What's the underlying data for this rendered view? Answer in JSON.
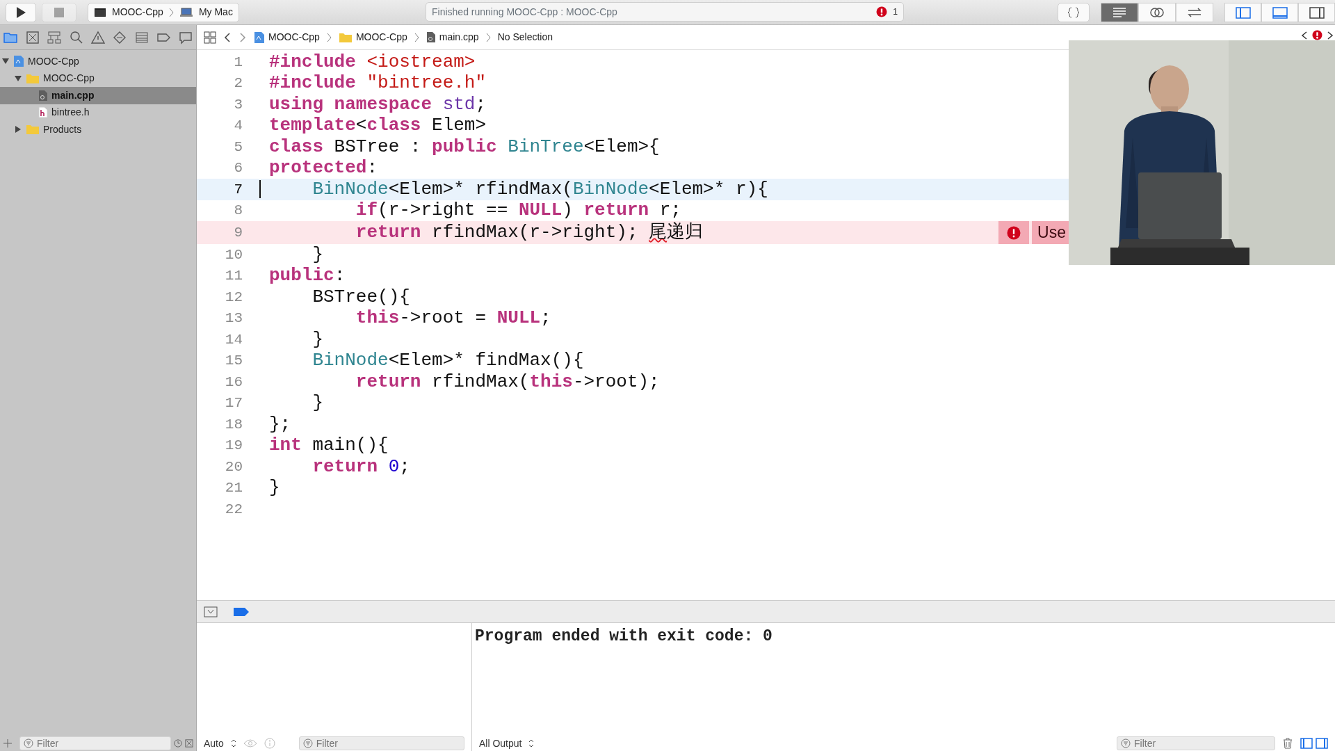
{
  "toolbar": {
    "run_button": {
      "disabled": false
    },
    "stop_button": {
      "disabled": true
    },
    "scheme": [
      {
        "label": "MOOC-Cpp",
        "kind": "app"
      },
      {
        "label": "My Mac",
        "kind": "mac"
      }
    ],
    "activity": {
      "text": "Finished running MOOC-Cpp : MOOC-Cpp",
      "error_count": "1"
    },
    "editor_modes": [
      {
        "kind": "braces",
        "selected": false
      }
    ],
    "editor_segments": [
      {
        "kind": "standard",
        "selected": true
      },
      {
        "kind": "assistant",
        "selected": false
      },
      {
        "kind": "version",
        "selected": false
      }
    ],
    "view_toggles": [
      {
        "kind": "navigator",
        "on": true
      },
      {
        "kind": "debug",
        "on": true
      },
      {
        "kind": "utilities",
        "on": false
      }
    ]
  },
  "navigator_tabs": [
    {
      "kind": "folder",
      "selected": true
    },
    {
      "kind": "source",
      "selected": false
    },
    {
      "kind": "symbol",
      "selected": false
    },
    {
      "kind": "search",
      "selected": false
    },
    {
      "kind": "warning",
      "selected": false
    },
    {
      "kind": "test",
      "selected": false
    },
    {
      "kind": "debug",
      "selected": false
    },
    {
      "kind": "breakpoint",
      "selected": false
    },
    {
      "kind": "report",
      "selected": false
    }
  ],
  "tree": [
    {
      "label": "MOOC-Cpp",
      "kind": "project",
      "expanded": true,
      "selected": false,
      "children": [
        {
          "label": "MOOC-Cpp",
          "kind": "folder",
          "expanded": true,
          "selected": false,
          "children": [
            {
              "label": "main.cpp",
              "kind": "cpp",
              "selected": true
            },
            {
              "label": "bintree.h",
              "kind": "header",
              "selected": false
            }
          ]
        },
        {
          "label": "Products",
          "kind": "folder",
          "expanded": false,
          "selected": false
        }
      ]
    }
  ],
  "sidebar_filter": {
    "placeholder": "Filter"
  },
  "jump_bar": [
    {
      "label": "MOOC-Cpp",
      "kind": "project"
    },
    {
      "label": "MOOC-Cpp",
      "kind": "folder"
    },
    {
      "label": "main.cpp",
      "kind": "cpp"
    },
    {
      "label": "No Selection",
      "kind": "none"
    }
  ],
  "code": [
    {
      "number": "1",
      "tokens": [
        {
          "text": "#include",
          "kind": "keyword"
        },
        {
          "text": " <iostream>",
          "kind": "string"
        }
      ]
    },
    {
      "number": "2",
      "tokens": [
        {
          "text": "#include",
          "kind": "keyword"
        },
        {
          "text": " \"bintree.h\"",
          "kind": "string"
        }
      ]
    },
    {
      "number": "3",
      "tokens": [
        {
          "text": "using",
          "kind": "keyword"
        },
        {
          "text": " namespace",
          "kind": "keyword"
        },
        {
          "text": " std",
          "kind": "library"
        },
        {
          "text": ";",
          "kind": "plain"
        }
      ]
    },
    {
      "number": "4",
      "tokens": [
        {
          "text": "template",
          "kind": "keyword"
        },
        {
          "text": "<",
          "kind": "plain"
        },
        {
          "text": "class",
          "kind": "keyword"
        },
        {
          "text": " Elem>",
          "kind": "plain"
        }
      ]
    },
    {
      "number": "5",
      "tokens": [
        {
          "text": "class",
          "kind": "keyword"
        },
        {
          "text": " BSTree : ",
          "kind": "plain"
        },
        {
          "text": "public",
          "kind": "keyword"
        },
        {
          "text": " BinTree",
          "kind": "type"
        },
        {
          "text": "<Elem>{",
          "kind": "plain"
        }
      ]
    },
    {
      "number": "6",
      "tokens": [
        {
          "text": "protected",
          "kind": "keyword"
        },
        {
          "text": ":",
          "kind": "plain"
        }
      ]
    },
    {
      "number": "7",
      "current": true,
      "tokens": [
        {
          "text": "    BinNode",
          "kind": "type"
        },
        {
          "text": "<Elem>* rfindMax(",
          "kind": "plain"
        },
        {
          "text": "BinNode",
          "kind": "type"
        },
        {
          "text": "<Elem>* r){",
          "kind": "plain"
        }
      ]
    },
    {
      "number": "8",
      "tokens": [
        {
          "text": "        if",
          "kind": "keyword"
        },
        {
          "text": "(r->right == ",
          "kind": "plain"
        },
        {
          "text": "NULL",
          "kind": "keyword"
        },
        {
          "text": ") ",
          "kind": "plain"
        },
        {
          "text": "return",
          "kind": "keyword"
        },
        {
          "text": " r;",
          "kind": "plain"
        }
      ]
    },
    {
      "number": "9",
      "error": "Use",
      "tokens": [
        {
          "text": "        return",
          "kind": "keyword"
        },
        {
          "text": " rfindMax(r->right); ",
          "kind": "plain"
        },
        {
          "text": "尾",
          "kind": "flagged"
        },
        {
          "text": "递归",
          "kind": "plain"
        }
      ]
    },
    {
      "number": "10",
      "tokens": [
        {
          "text": "    }",
          "kind": "plain"
        }
      ]
    },
    {
      "number": "11",
      "tokens": [
        {
          "text": "public",
          "kind": "keyword"
        },
        {
          "text": ":",
          "kind": "plain"
        }
      ]
    },
    {
      "number": "12",
      "tokens": [
        {
          "text": "    BSTree(){",
          "kind": "plain"
        }
      ]
    },
    {
      "number": "13",
      "tokens": [
        {
          "text": "        this",
          "kind": "keyword"
        },
        {
          "text": "->root = ",
          "kind": "plain"
        },
        {
          "text": "NULL",
          "kind": "keyword"
        },
        {
          "text": ";",
          "kind": "plain"
        }
      ]
    },
    {
      "number": "14",
      "tokens": [
        {
          "text": "    }",
          "kind": "plain"
        }
      ]
    },
    {
      "number": "15",
      "tokens": [
        {
          "text": "    BinNode",
          "kind": "type"
        },
        {
          "text": "<Elem>* findMax(){",
          "kind": "plain"
        }
      ]
    },
    {
      "number": "16",
      "tokens": [
        {
          "text": "        return",
          "kind": "keyword"
        },
        {
          "text": " rfindMax(",
          "kind": "plain"
        },
        {
          "text": "this",
          "kind": "keyword"
        },
        {
          "text": "->root);",
          "kind": "plain"
        }
      ]
    },
    {
      "number": "17",
      "tokens": [
        {
          "text": "    }",
          "kind": "plain"
        }
      ]
    },
    {
      "number": "18",
      "tokens": [
        {
          "text": "};",
          "kind": "plain"
        }
      ]
    },
    {
      "number": "19",
      "tokens": [
        {
          "text": "int",
          "kind": "keyword"
        },
        {
          "text": " main(){",
          "kind": "plain"
        }
      ]
    },
    {
      "number": "20",
      "tokens": [
        {
          "text": "    return",
          "kind": "keyword"
        },
        {
          "text": " 0",
          "kind": "number"
        },
        {
          "text": ";",
          "kind": "plain"
        }
      ]
    },
    {
      "number": "21",
      "tokens": [
        {
          "text": "}",
          "kind": "plain"
        }
      ]
    },
    {
      "number": "22"
    }
  ],
  "debug_bar": {
    "breakpoints_on": true
  },
  "variables_footer": {
    "scope": "Auto",
    "filter": {
      "placeholder": "Filter"
    }
  },
  "console": {
    "output": "Program ended with exit code: 0",
    "mode": "All Output",
    "filter": {
      "placeholder": "Filter"
    },
    "panes": [
      {
        "kind": "variables",
        "on": true
      },
      {
        "kind": "console",
        "on": true
      }
    ]
  }
}
